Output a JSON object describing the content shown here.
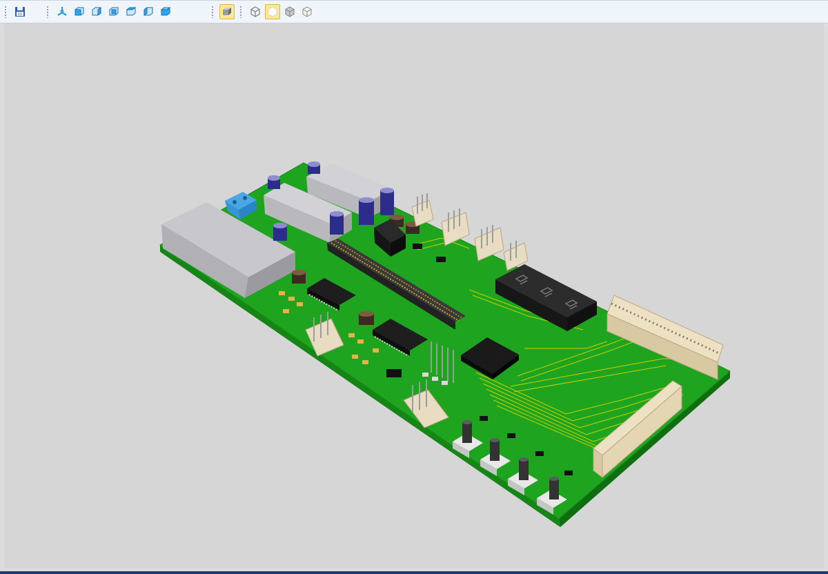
{
  "toolbar": {
    "groups": [
      {
        "items": [
          {
            "name": "save-3d-icon",
            "active": false
          }
        ]
      },
      {
        "items": [
          {
            "name": "view-isometric-icon",
            "active": false
          },
          {
            "name": "view-front-icon",
            "active": false
          },
          {
            "name": "view-back-icon",
            "active": false
          },
          {
            "name": "view-left-icon",
            "active": false
          },
          {
            "name": "view-right-icon",
            "active": false
          },
          {
            "name": "view-top-icon",
            "active": false
          },
          {
            "name": "view-bottom-icon",
            "active": false
          }
        ]
      },
      {
        "items": [
          {
            "name": "shaded-mode-icon",
            "active": true
          },
          {
            "name": "wireframe-mode-icon",
            "active": false
          },
          {
            "name": "solid-mode-icon",
            "active": true
          },
          {
            "name": "hidden-lines-icon",
            "active": false
          },
          {
            "name": "transparent-mode-icon",
            "active": false
          }
        ]
      }
    ]
  },
  "colors": {
    "background": "#d6d6d6",
    "pcb": "#1fa81f",
    "pcb_edge": "#168a16",
    "trace": "#c8d400",
    "toolbar": "#f0f4fb",
    "active_button": "#fbe994"
  }
}
